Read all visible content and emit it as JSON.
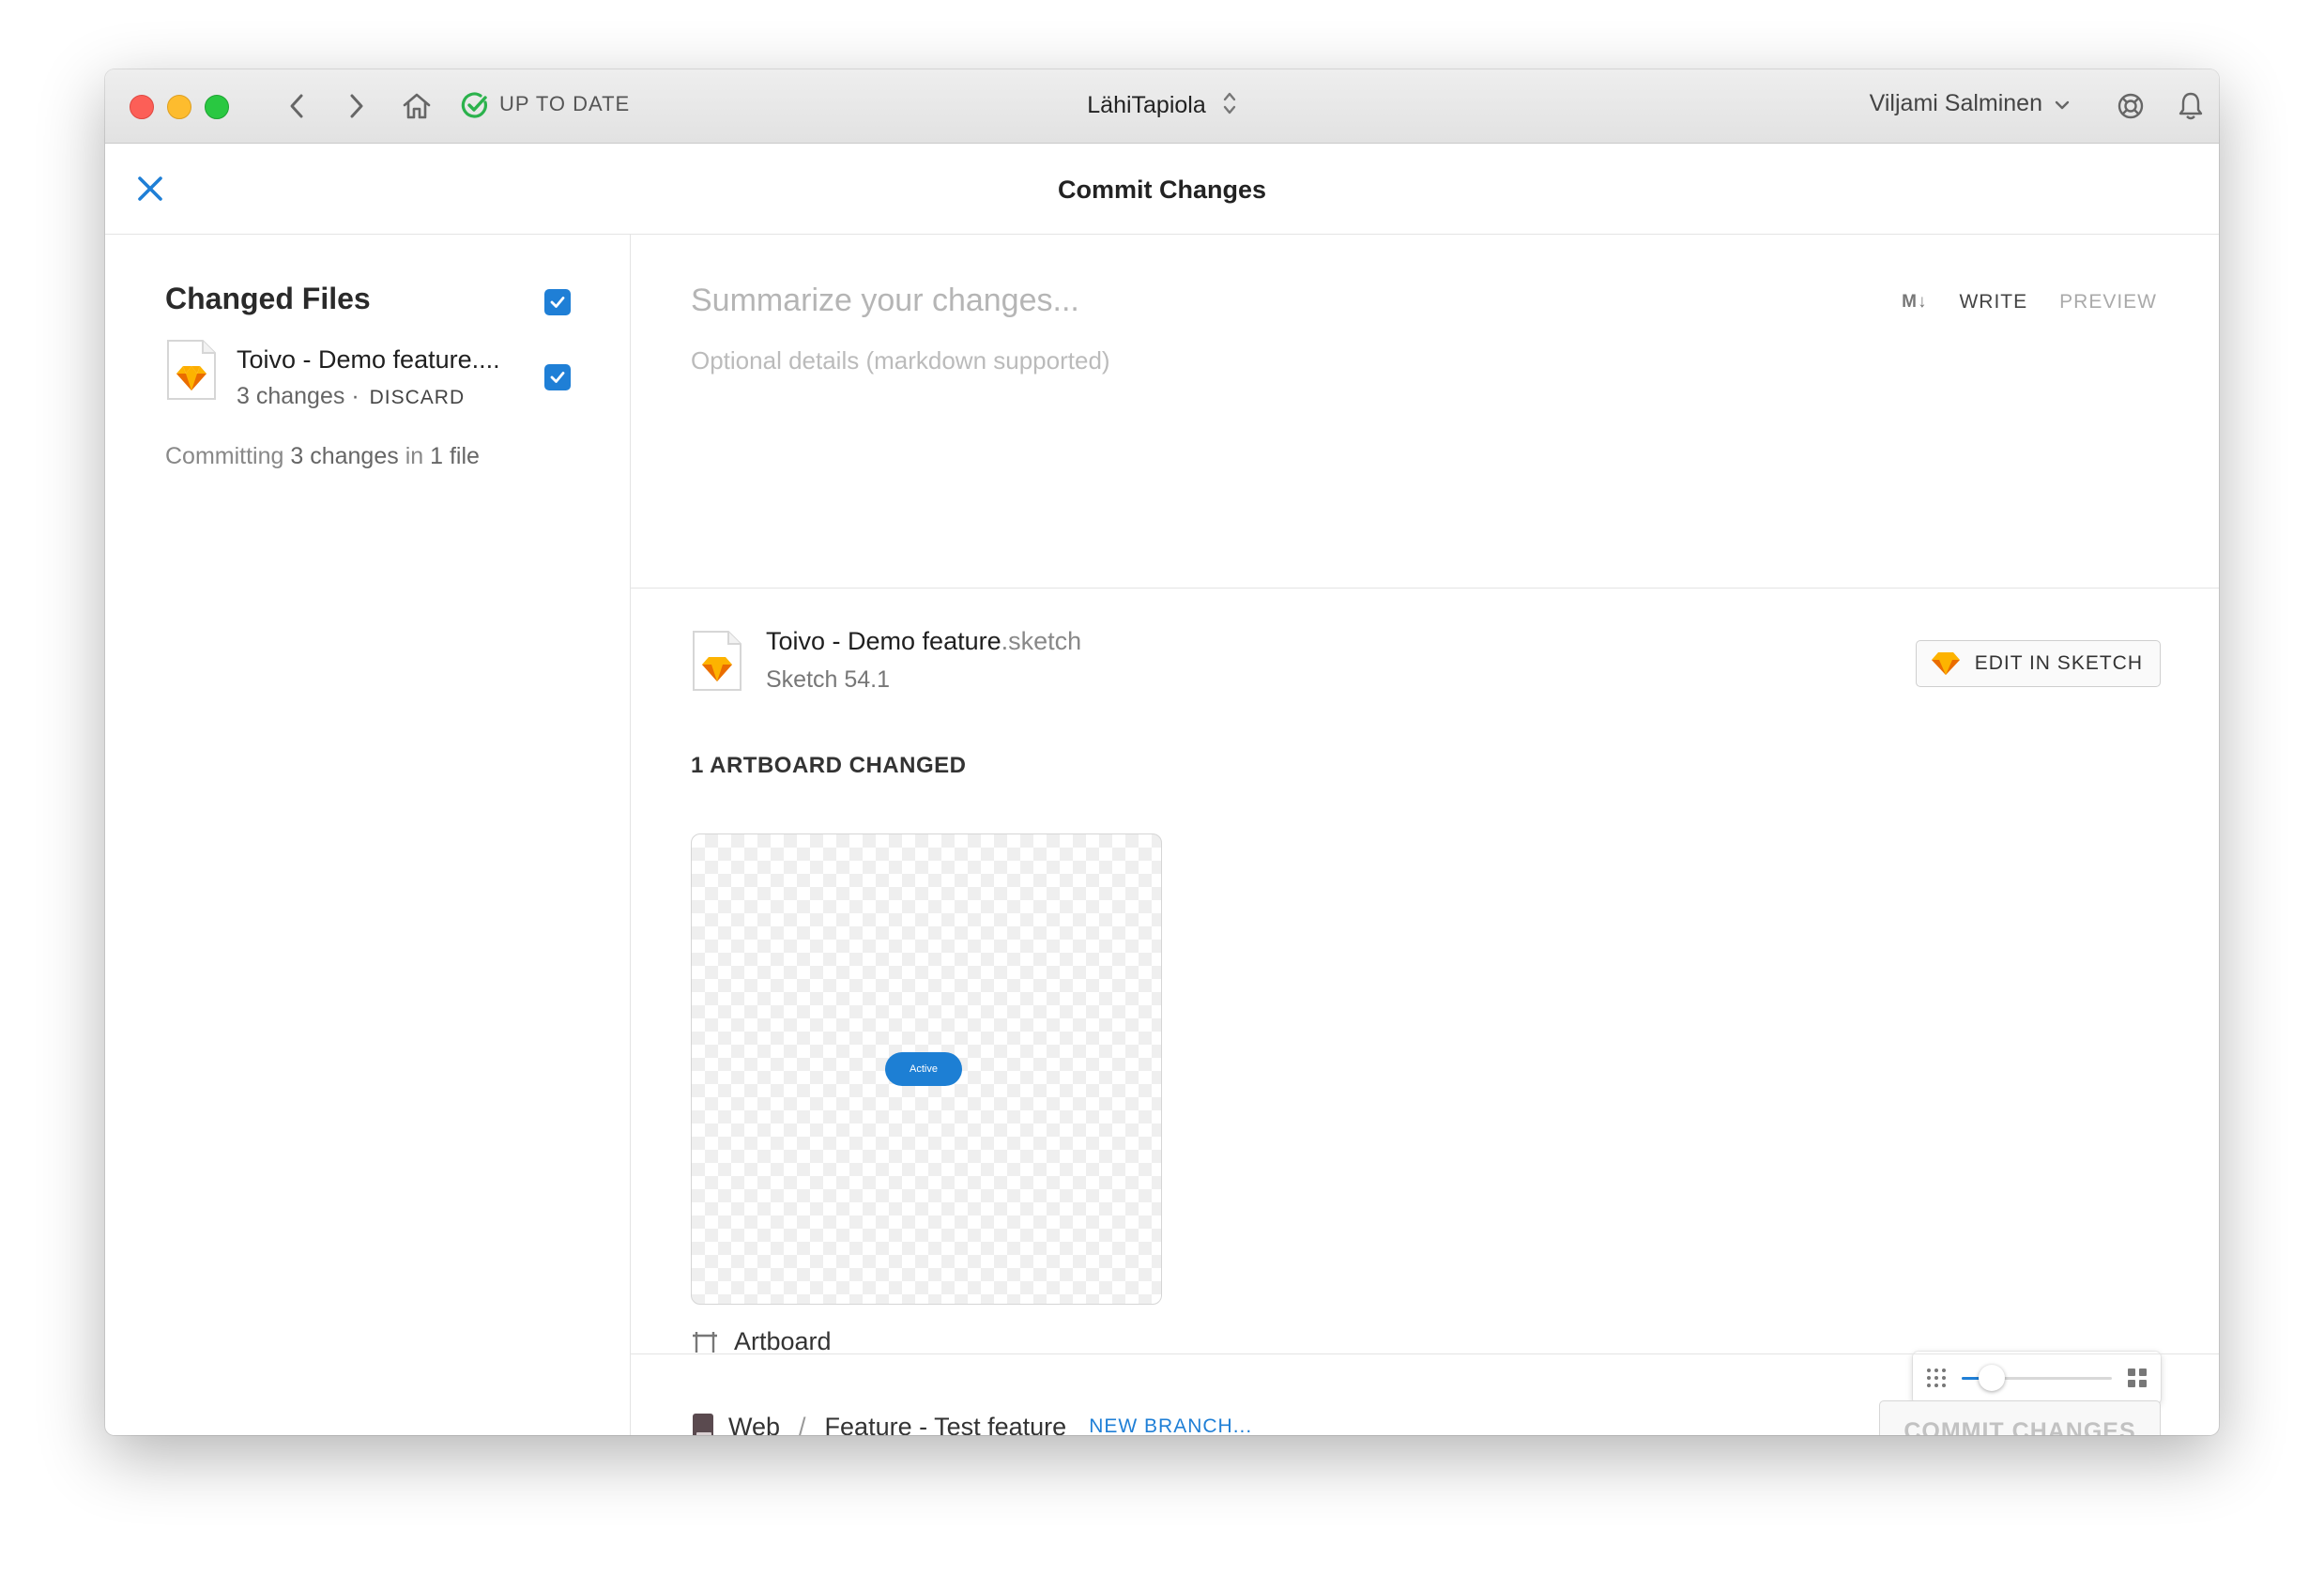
{
  "titlebar": {
    "sync_status": "UP TO DATE",
    "project_name": "LähiTapiola",
    "user_name": "Viljami Salminen"
  },
  "header": {
    "title": "Commit Changes"
  },
  "sidebar": {
    "title": "Changed Files",
    "file": {
      "name": "Toivo - Demo feature....",
      "changes": "3 changes",
      "separator": "·",
      "discard_label": "DISCARD"
    },
    "summary": {
      "prefix": "Committing",
      "changes": "3 changes",
      "middle": "in",
      "files": "1 file"
    }
  },
  "editor": {
    "summary_placeholder": "Summarize your changes...",
    "details_placeholder": "Optional details (markdown supported)",
    "markdown_badge": "M↓",
    "write_label": "WRITE",
    "preview_label": "PREVIEW"
  },
  "file_detail": {
    "name": "Toivo - Demo feature",
    "extension": ".sketch",
    "version": "Sketch 54.1",
    "edit_button_label": "EDIT IN SKETCH",
    "artboards_changed": "1 ARTBOARD CHANGED",
    "artboard_preview_button": "Active",
    "artboard_name": "Artboard"
  },
  "zoom": {
    "value_fraction": 0.2
  },
  "footer": {
    "project": "Web",
    "separator": "/",
    "branch": "Feature - Test feature",
    "new_branch_label": "NEW BRANCH...",
    "commit_button_label": "COMMIT CHANGES"
  },
  "colors": {
    "accent": "#1f7fd6",
    "sketch_orange": "#f7a61b",
    "status_green": "#2bb24c"
  },
  "icons": [
    "chevron-left-icon",
    "chevron-right-icon",
    "home-icon",
    "check-circle-icon",
    "chevron-up-down-icon",
    "chevron-down-icon",
    "lifebuoy-icon",
    "bell-icon",
    "close-icon",
    "checkmark-icon",
    "sketch-file-icon",
    "artboard-icon",
    "grid-small-icon",
    "grid-large-icon",
    "book-icon"
  ]
}
